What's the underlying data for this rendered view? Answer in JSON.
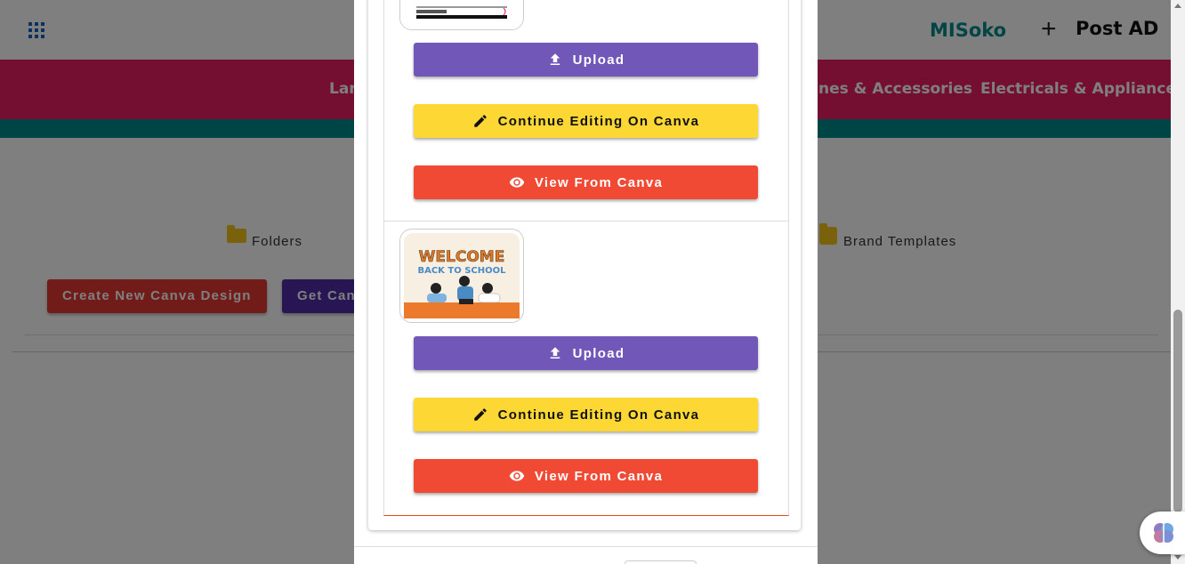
{
  "header": {
    "brand": "MISoko",
    "post_ad_label": "Post AD",
    "apps_icon": "apps-grid-icon",
    "plus_icon": "plus-icon"
  },
  "nav": {
    "items": [
      {
        "label": "Lar"
      },
      {
        "label": "nes & Accessories"
      },
      {
        "label": "Electricals & Appliances"
      }
    ]
  },
  "canva_panel": {
    "folders_label": "Folders",
    "brand_templates_label": "Brand Templates",
    "create_button": "Create New Canva Design",
    "get_button": "Get Canv"
  },
  "modal": {
    "items": [
      {
        "upload_label": "Upload",
        "edit_label": "Continue Editing On Canva",
        "view_label": "View From Canva"
      },
      {
        "thumbnail_title": "WELCOME",
        "thumbnail_subtitle": "BACK TO SCHOOL",
        "upload_label": "Upload",
        "edit_label": "Continue Editing On Canva",
        "view_label": "View From Canva"
      }
    ]
  },
  "colors": {
    "upload": "#7057b8",
    "edit": "#fdd835",
    "view": "#f04a34",
    "nav": "#e91e63",
    "brand": "#008b8b"
  }
}
